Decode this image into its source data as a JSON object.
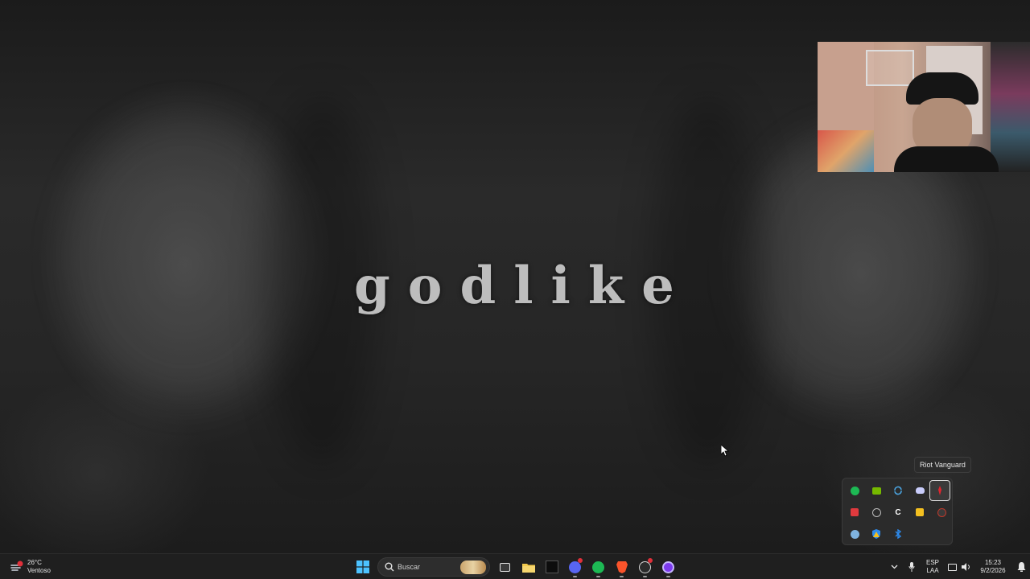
{
  "wallpaper": {
    "title": "godlike"
  },
  "tooltip": {
    "text": "Riot Vanguard"
  },
  "tray_flyout": {
    "icons": [
      {
        "name": "spotify-icon",
        "color": "#1db954"
      },
      {
        "name": "nvidia-icon",
        "color": "#76b900"
      },
      {
        "name": "sync-icon",
        "color": "#4aa3df"
      },
      {
        "name": "discord-icon",
        "color": "#c9cdfb"
      },
      {
        "name": "riot-vanguard-icon",
        "color": "#e0262f"
      },
      {
        "name": "red-app-icon",
        "color": "#e03a3e"
      },
      {
        "name": "globe-icon",
        "color": "#bdbdbd"
      },
      {
        "name": "c-app-icon",
        "color": "#ffffff"
      },
      {
        "name": "yellow-app-icon",
        "color": "#f4c020"
      },
      {
        "name": "gear-dark-icon",
        "color": "#c0392b"
      },
      {
        "name": "steam-icon",
        "color": "#7fb3e0"
      },
      {
        "name": "security-shield-icon",
        "color": "#f4c020"
      },
      {
        "name": "bluetooth-icon",
        "color": "#2d8cf0"
      }
    ]
  },
  "taskbar": {
    "weather": {
      "temp": "26°C",
      "condition": "Ventoso"
    },
    "search": {
      "placeholder": "Buscar"
    },
    "apps": [
      {
        "name": "task-view-icon"
      },
      {
        "name": "file-explorer-icon"
      },
      {
        "name": "call-of-duty-icon"
      },
      {
        "name": "discord-icon"
      },
      {
        "name": "spotify-icon"
      },
      {
        "name": "brave-icon"
      },
      {
        "name": "obs-icon"
      },
      {
        "name": "purple-app-icon"
      }
    ],
    "language": {
      "line1": "ESP",
      "line2": "LAA"
    },
    "clock": {
      "time": "15:23",
      "date": "9/2/2026"
    }
  },
  "colors": {
    "accent_windows": "#4cc2ff",
    "taskbar_bg": "#1f1f1f"
  }
}
